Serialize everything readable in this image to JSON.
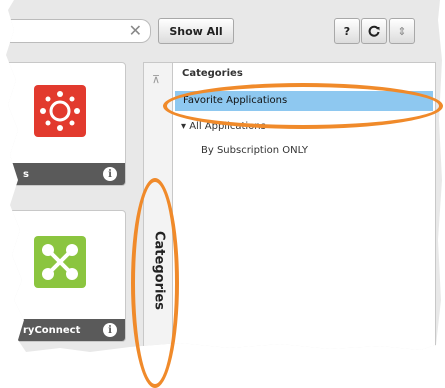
{
  "toolbar": {
    "search_clear_icon": "close-icon",
    "show_all_label": "Show All",
    "help_label": "?",
    "refresh_icon": "refresh-icon",
    "sort_icon": "sort-icon"
  },
  "tiles": [
    {
      "label": "s",
      "icon": "canvas-logo",
      "info": "i"
    },
    {
      "label": "ryConnect",
      "icon": "connect-logo",
      "info": "i"
    }
  ],
  "categories_tab": {
    "label": "Categories",
    "pin_icon": "pin-icon"
  },
  "categories_panel": {
    "title": "Categories",
    "items": [
      {
        "label": "Favorite Applications",
        "selected": true
      },
      {
        "label": "▾ All Applications",
        "selected": false
      },
      {
        "label": "By Subscription ONLY",
        "selected": false
      }
    ]
  },
  "colors": {
    "highlight": "#8ec8f0",
    "annotation_ring": "#f08a2a",
    "tile_bar": "#5a5a5a"
  }
}
